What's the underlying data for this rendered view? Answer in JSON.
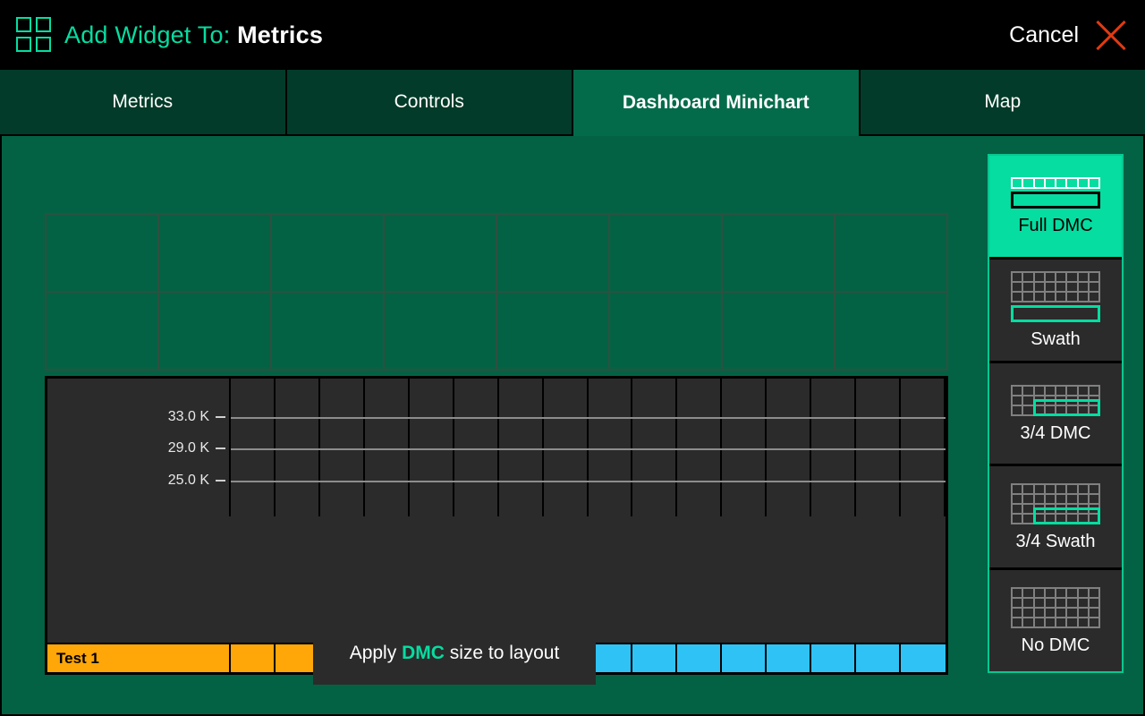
{
  "header": {
    "icon": "grid-2x2-icon",
    "prefix": "Add Widget To: ",
    "target": "Metrics",
    "cancel_label": "Cancel",
    "close_icon": "close-x-icon",
    "accent_color": "#06dda0",
    "close_color": "#e03a12"
  },
  "tabs": [
    {
      "label": "Metrics",
      "active": false
    },
    {
      "label": "Controls",
      "active": false
    },
    {
      "label": "Dashboard Minichart",
      "active": true
    },
    {
      "label": "Map",
      "active": false
    }
  ],
  "layout_grid": {
    "columns": 8,
    "rows": 2
  },
  "apply_button": {
    "text_before": "Apply ",
    "accent": "DMC",
    "text_after": " size to layout"
  },
  "options": [
    {
      "label": "Full DMC",
      "icon": "full-dmc-icon",
      "selected": true
    },
    {
      "label": "Swath",
      "icon": "swath-icon",
      "selected": false
    },
    {
      "label": "3/4 DMC",
      "icon": "three-quarter-dmc-icon",
      "selected": false
    },
    {
      "label": "3/4 Swath",
      "icon": "three-quarter-swath-icon",
      "selected": false
    },
    {
      "label": "No DMC",
      "icon": "no-dmc-icon",
      "selected": false
    }
  ],
  "chart_data": {
    "type": "bar",
    "title": "",
    "xlabel": "",
    "ylabel": "",
    "series_label": "Test 1",
    "y_ticks": [
      "33.0 K",
      "29.0 K",
      "25.0 K"
    ],
    "y_tick_values": [
      33000,
      29000,
      25000
    ],
    "ylim": [
      23000,
      35000
    ],
    "grid": true,
    "columns": 16,
    "legend": "none",
    "bar_colors": {
      "orange": "#ffa608",
      "cyan": "#2fc3f5"
    },
    "bar_cells": [
      "orange",
      "orange",
      "orange",
      "orange",
      "orange",
      "orange",
      "orange",
      "orange",
      "cyan",
      "cyan",
      "cyan",
      "cyan",
      "cyan",
      "cyan",
      "cyan",
      "cyan"
    ]
  }
}
